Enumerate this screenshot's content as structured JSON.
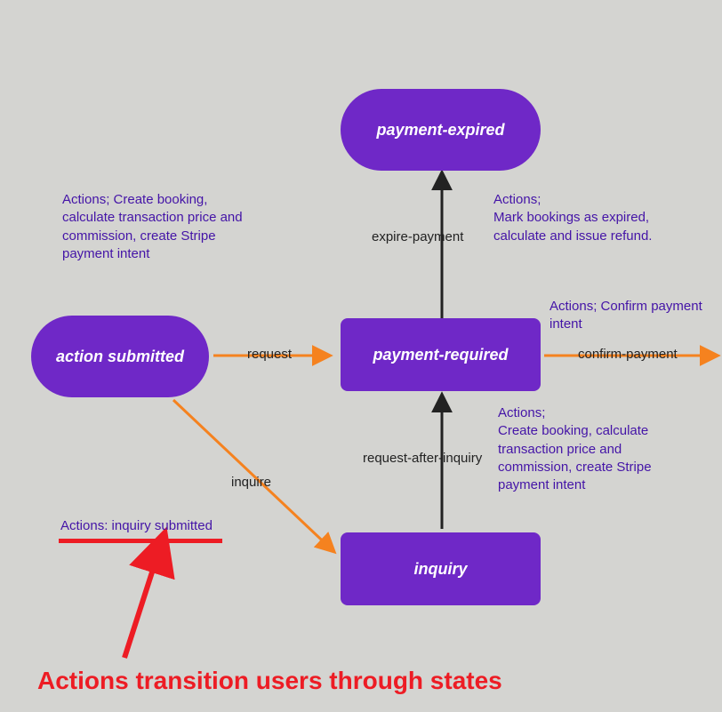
{
  "nodes": {
    "payment_expired": {
      "label": "payment-expired"
    },
    "action_submitted": {
      "label": "action submitted"
    },
    "payment_required": {
      "label": "payment-required"
    },
    "inquiry": {
      "label": "inquiry"
    }
  },
  "transitions": {
    "expire_payment": {
      "label": "expire-payment"
    },
    "request": {
      "label": "request"
    },
    "confirm_payment": {
      "label": "confirm-payment"
    },
    "inquire": {
      "label": "inquire"
    },
    "request_after_inquiry": {
      "label": "request-after-inquiry"
    }
  },
  "actions": {
    "create_booking_1": "Actions; Create booking, calculate transaction price and commission, create Stripe payment intent",
    "expired_refund": "Actions;\nMark bookings as expired, calculate and issue refund.",
    "confirm_intent": "Actions; Confirm payment intent",
    "create_booking_2": "Actions;\nCreate booking, calculate transaction price and commission, create Stripe payment intent",
    "inquiry_submitted": "Actions: inquiry submitted"
  },
  "caption": "Actions transition users through states"
}
